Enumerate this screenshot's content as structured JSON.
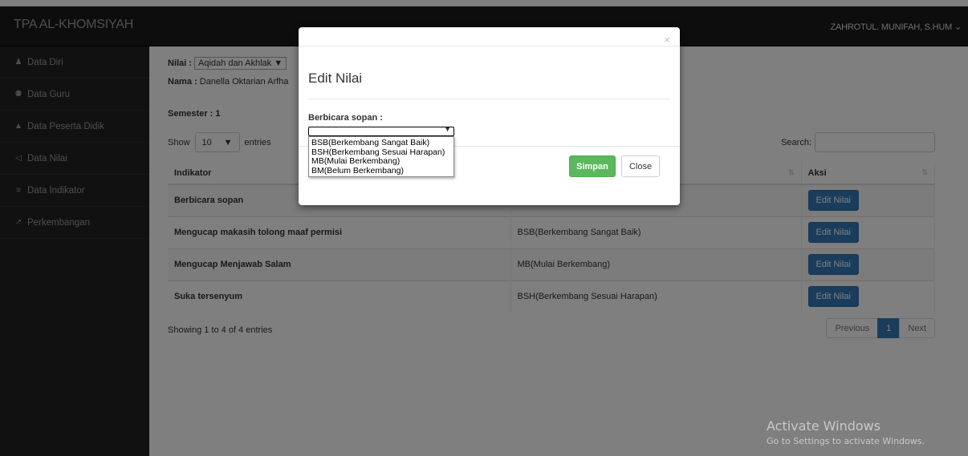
{
  "navbar": {
    "brand": "TPA AL-KHOMSIYAH",
    "user": "ZAHROTUL. MUNIFAH, S.HUM ⌄"
  },
  "sidebar": {
    "items": [
      {
        "icon": "user-icon",
        "glyph": "♟",
        "label": "Data Diri"
      },
      {
        "icon": "users-icon",
        "glyph": "⚉",
        "label": "Data Guru"
      },
      {
        "icon": "graduation-cap-icon",
        "glyph": "▲",
        "label": "Data Peserta Didik"
      },
      {
        "icon": "send-icon",
        "glyph": "◁",
        "label": "Data Nilai"
      },
      {
        "icon": "list-icon",
        "glyph": "≡",
        "label": "Data Indikator"
      },
      {
        "icon": "chart-line-icon",
        "glyph": "↗",
        "label": "Perkembangan"
      }
    ]
  },
  "main": {
    "nilai_label": "Nilai :",
    "nilai_value": "Aqidah dan Akhlak",
    "nama_label": "Nama :",
    "nama_value": "Danella Oktarian Arfha",
    "semester_label": "Semester :",
    "semester_value": "1",
    "show_label": "Show",
    "entries_value": "10",
    "entries_label": "entries",
    "search_label": "Search:",
    "search_value": "",
    "table": {
      "headers": [
        "Indikator",
        "",
        "Aksi"
      ],
      "rows": [
        {
          "indikator": "Berbicara sopan",
          "nilai": "",
          "aksi": "Edit Nilai"
        },
        {
          "indikator": "Mengucap makasih tolong maaf permisi",
          "nilai": "BSB(Berkembang Sangat Baik)",
          "aksi": "Edit Nilai"
        },
        {
          "indikator": "Mengucap Menjawab Salam",
          "nilai": "MB(Mulai Berkembang)",
          "aksi": "Edit Nilai"
        },
        {
          "indikator": "Suka tersenyum",
          "nilai": "BSH(Berkembang Sesuai Harapan)",
          "aksi": "Edit Nilai"
        }
      ]
    },
    "info": "Showing 1 to 4 of 4 entries",
    "pagination": {
      "previous": "Previous",
      "page": "1",
      "next": "Next"
    }
  },
  "watermark": {
    "title": "Activate Windows",
    "subtitle": "Go to Settings to activate Windows."
  },
  "modal": {
    "close": "×",
    "title": "Edit Nilai",
    "field_label": "Berbicara sopan :",
    "field_value": "",
    "options": [
      "BSB(Berkembang Sangat Baik)",
      "BSH(Berkembang Sesuai Harapan)",
      "MB(Mulai Berkembang)",
      "BM(Belum Berkembang)"
    ],
    "save_label": "Simpan",
    "close_label": "Close"
  }
}
